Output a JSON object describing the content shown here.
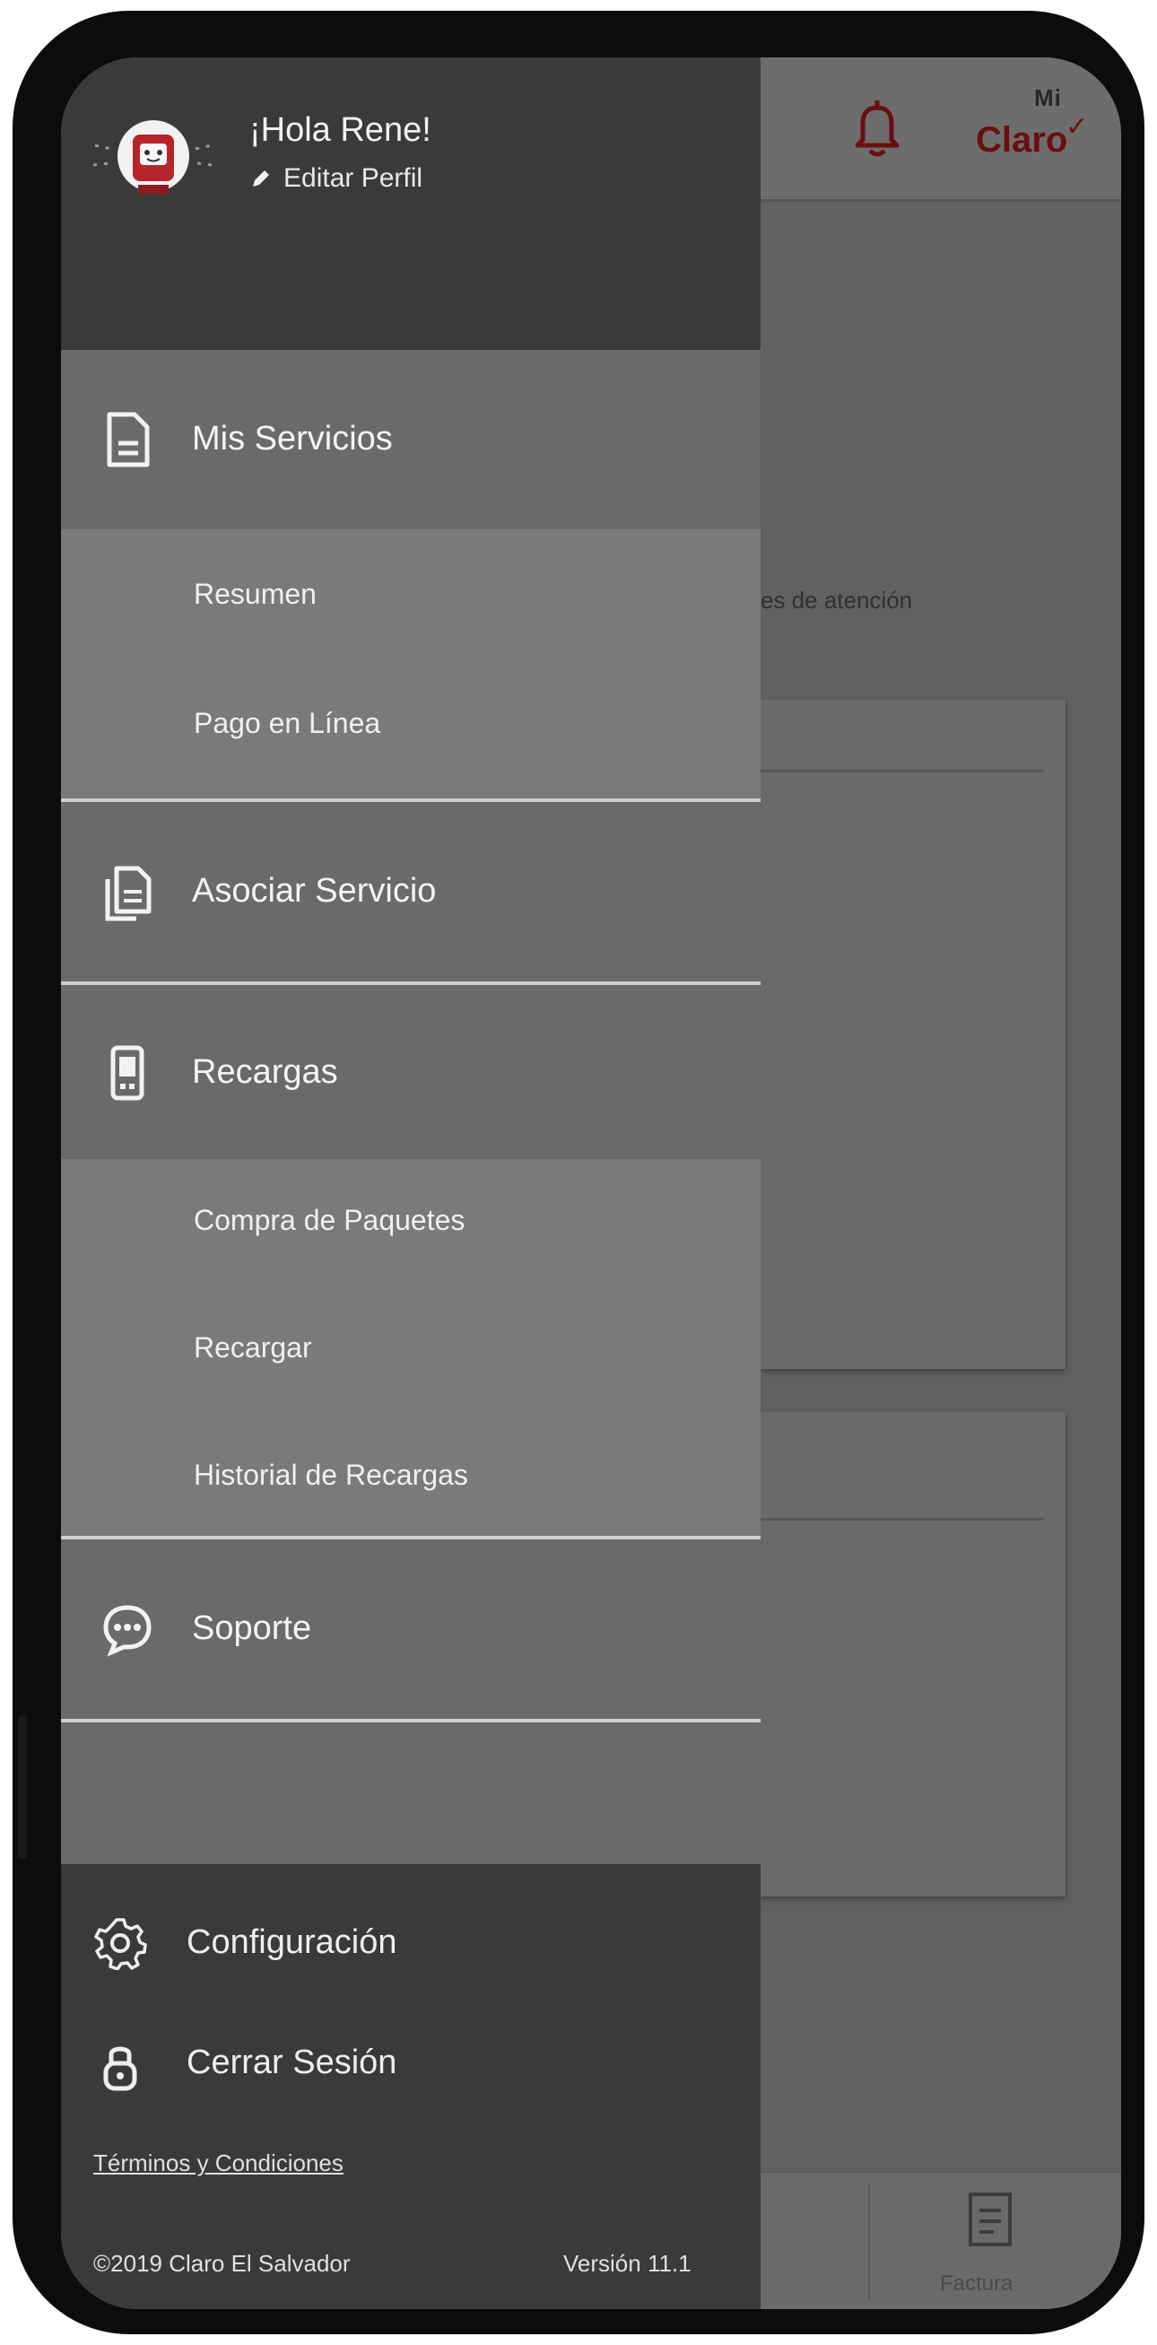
{
  "header": {
    "greeting": "¡Hola Rene!",
    "edit_profile": "Editar Perfil"
  },
  "menu": {
    "mis_servicios": {
      "label": "Mis Servicios",
      "icon": "document-icon",
      "items": [
        "Resumen",
        "Pago en Línea"
      ]
    },
    "asociar_servicio": {
      "label": "Asociar Servicio",
      "icon": "copy-document-icon"
    },
    "recargas": {
      "label": "Recargas",
      "icon": "phone-icon",
      "items": [
        "Compra de Paquetes",
        "Recargar",
        "Historial de Recargas"
      ]
    },
    "soporte": {
      "label": "Soporte",
      "icon": "chat-bubble-icon"
    }
  },
  "footer": {
    "configuracion": "Configuración",
    "cerrar_sesion": "Cerrar Sesión",
    "terms": "Términos y Condiciones",
    "copyright": "©2019 Claro El Salvador",
    "version": "Versión 11.1"
  },
  "background_app": {
    "logo_top": "Mi",
    "logo_word": "Claro",
    "partial_text": "es de atención",
    "tab_label": "Factura"
  },
  "colors": {
    "accent": "#8e1b20",
    "drawer_header": "#3a3a3a",
    "drawer_body": "#6a6a6a",
    "submenu": "#7a7a7a",
    "text": "#f4f4f4"
  }
}
